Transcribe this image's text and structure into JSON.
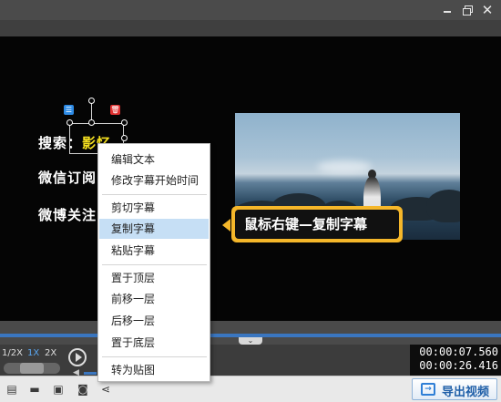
{
  "window": {
    "minimize_icon": "minimize-icon",
    "restore_icon": "restore-icon",
    "close_glyph": "✕"
  },
  "preview": {
    "subtitles": {
      "search_prefix": "搜索：",
      "search_keyword": "影忆",
      "wechat": "微信订阅",
      "weibo": "微博关注"
    },
    "list_badge": "☰",
    "delete_badge": "🗑",
    "callout_text": "鼠标右键—复制字幕"
  },
  "context_menu": {
    "items": [
      "编辑文本",
      "修改字幕开始时间",
      "剪切字幕",
      "复制字幕",
      "粘贴字幕",
      "置于顶层",
      "前移一层",
      "后移一层",
      "置于底层",
      "转为贴图"
    ],
    "active_item": "复制字幕"
  },
  "playback": {
    "speed_half": "1/2X",
    "speed_one": "1X",
    "speed_two": "2X",
    "seek_tab_glyph": "⌄"
  },
  "timecode": {
    "current": "00:00:07.560",
    "total": "00:00:26.416"
  },
  "toolbar": {
    "icons": [
      "new-project-icon",
      "open-folder-icon",
      "save-icon",
      "save-as-icon",
      "share-icon"
    ],
    "export_label": "导出视频"
  },
  "colors": {
    "subtitle_highlight": "#f5e020",
    "callout_border": "#f5b72a",
    "menu_active": "#c6dff5",
    "accent_blue": "#3a76c0"
  }
}
